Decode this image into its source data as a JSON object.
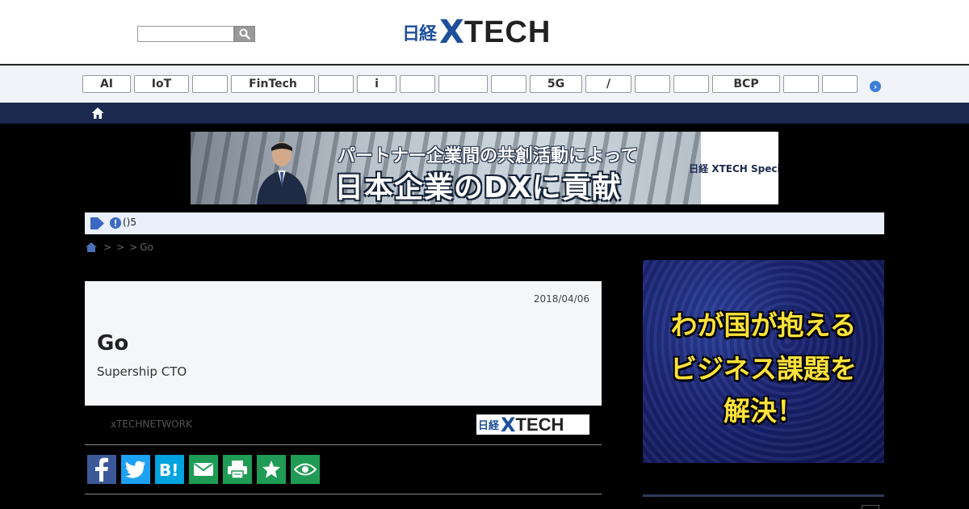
{
  "header": {
    "search_placeholder": "",
    "logo_nikkei": "日経",
    "logo_x": "X",
    "logo_tech": "TECH"
  },
  "tags": [
    "AI",
    "IoT",
    "",
    "FinTech",
    "",
    "i",
    "",
    "",
    "",
    "5G",
    "/",
    "",
    "",
    "BCP",
    "",
    ""
  ],
  "banner": {
    "line1": "パートナー企業間の共創活動によって",
    "line2": "日本企業のDXに貢献",
    "logo_text": "日経 XTECH Special"
  },
  "notice": {
    "text": "()5"
  },
  "breadcrumb": {
    "items": [
      "",
      "",
      "Go"
    ],
    "separator": ">"
  },
  "article": {
    "date": "2018/04/06",
    "title": "Go",
    "subtitle": "Supership CTO",
    "network_label": "xTECHNETWORK",
    "network_logo": {
      "nikkei": "日経",
      "x": "X",
      "tech": "TECH"
    }
  },
  "ad": {
    "line1": "わが国が抱える",
    "line2": "ビジネス課題を",
    "line3": "解決！"
  },
  "colors": {
    "brand_blue": "#1d4f9a",
    "nav_navy": "#1b2a4e",
    "share_green": "#1f9b55",
    "facebook": "#3b5998",
    "twitter": "#1da1f2",
    "hatena": "#00a4de"
  },
  "icons": [
    "search-icon",
    "chevron-right-icon",
    "home-icon",
    "play-icon",
    "alert-icon",
    "facebook-icon",
    "twitter-icon",
    "hatena-bookmark-icon",
    "mail-icon",
    "print-icon",
    "star-icon",
    "eye-icon"
  ]
}
